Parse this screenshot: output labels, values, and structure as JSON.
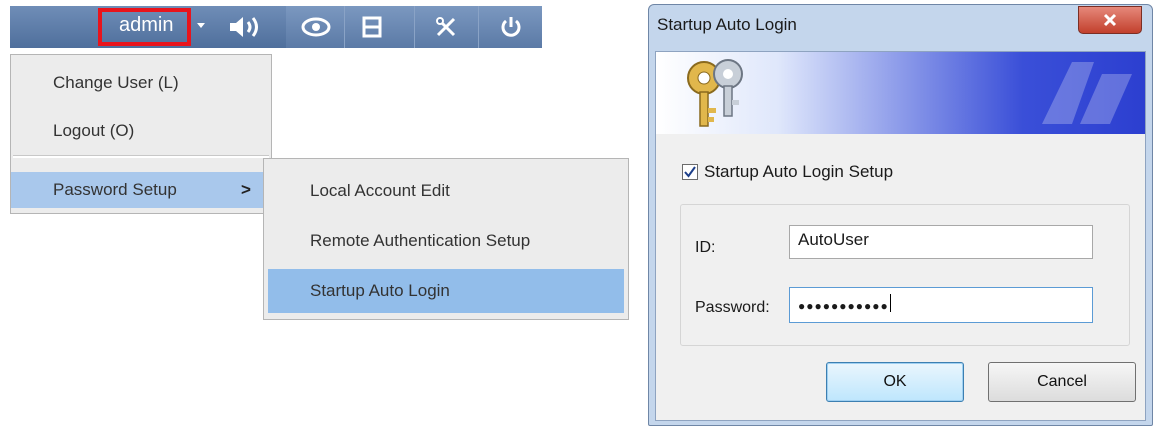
{
  "toolbar": {
    "user_label": "admin",
    "icons": [
      "volume-icon",
      "eye-icon",
      "film-icon",
      "tools-icon",
      "power-icon"
    ]
  },
  "menu": {
    "items": [
      {
        "label": "Change User (L)"
      },
      {
        "label": "Logout (O)"
      },
      {
        "label": "Password Setup",
        "arrow": ">"
      }
    ]
  },
  "submenu": {
    "items": [
      {
        "label": "Local Account Edit"
      },
      {
        "label": "Remote Authentication Setup"
      },
      {
        "label": "Startup Auto Login"
      }
    ]
  },
  "dialog": {
    "title": "Startup Auto Login",
    "checkbox_label": "Startup Auto Login Setup",
    "checkbox_checked": true,
    "id_label": "ID:",
    "id_value": "AutoUser",
    "password_label": "Password:",
    "password_mask": "●●●●●●●●●●●",
    "ok_label": "OK",
    "cancel_label": "Cancel"
  },
  "colors": {
    "toolbar": "#5b7aa6",
    "highlight_box": "#e8141c",
    "menu_active": "#a9c8ec",
    "submenu_active": "#92bdea",
    "dialog_frame": "#c4d6ec",
    "banner_blue": "#2c3fd0"
  }
}
